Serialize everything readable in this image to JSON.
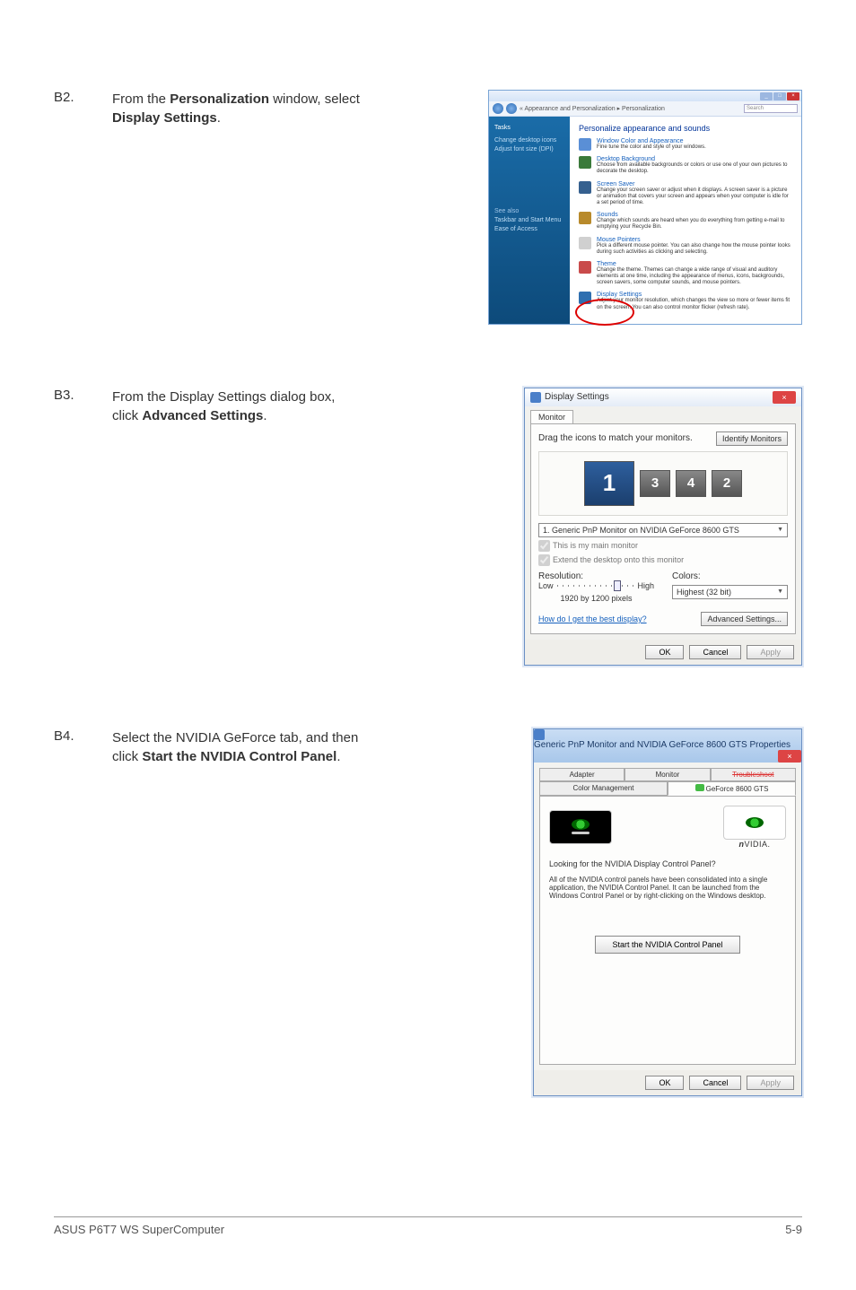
{
  "steps": {
    "b2": {
      "label": "B2.",
      "text_pre": "From the ",
      "bold1": "Personalization",
      "mid": " window, select ",
      "bold2": "Display Settings",
      "post": "."
    },
    "b3": {
      "label": "B3.",
      "text_pre": "From the Display Settings dialog box, click ",
      "bold1": "Advanced Settings",
      "post": "."
    },
    "b4": {
      "label": "B4.",
      "text_pre": "Select the NVIDIA GeForce tab, and then click ",
      "bold1": "Start the NVIDIA Control Panel",
      "post": "."
    }
  },
  "vista": {
    "breadcrumb": "« Appearance and Personalization ▸ Personalization",
    "search_ph": "Search",
    "tasks": "Tasks",
    "side1": "Change desktop icons",
    "side2": "Adjust font size (DPI)",
    "seealso": "See also",
    "side3": "Taskbar and Start Menu",
    "side4": "Ease of Access",
    "heading": "Personalize appearance and sounds",
    "items": [
      {
        "title": "Window Color and Appearance",
        "desc": "Fine tune the color and style of your windows.",
        "iconColor": "#5a8fd6"
      },
      {
        "title": "Desktop Background",
        "desc": "Choose from available backgrounds or colors or use one of your own pictures to decorate the desktop.",
        "iconColor": "#3a7a3a"
      },
      {
        "title": "Screen Saver",
        "desc": "Change your screen saver or adjust when it displays. A screen saver is a picture or animation that covers your screen and appears when your computer is idle for a set period of time.",
        "iconColor": "#35608f"
      },
      {
        "title": "Sounds",
        "desc": "Change which sounds are heard when you do everything from getting e-mail to emptying your Recycle Bin.",
        "iconColor": "#b88a2b"
      },
      {
        "title": "Mouse Pointers",
        "desc": "Pick a different mouse pointer. You can also change how the mouse pointer looks during such activities as clicking and selecting.",
        "iconColor": "#d0d0d0"
      },
      {
        "title": "Theme",
        "desc": "Change the theme. Themes can change a wide range of visual and auditory elements at one time, including the appearance of menus, icons, backgrounds, screen savers, some computer sounds, and mouse pointers.",
        "iconColor": "#c94b4b"
      },
      {
        "title": "Display Settings",
        "desc": "Adjust your monitor resolution, which changes the view so more or fewer items fit on the screen. You can also control monitor flicker (refresh rate).",
        "iconColor": "#2f6fb0"
      }
    ]
  },
  "display": {
    "title": "Display Settings",
    "tab": "Monitor",
    "drag": "Drag the icons to match your monitors.",
    "identify": "Identify Monitors",
    "monitor_combo": "1. Generic PnP Monitor on NVIDIA GeForce 8600 GTS",
    "chk_main": "This is my main monitor",
    "chk_extend": "Extend the desktop onto this monitor",
    "res_label": "Resolution:",
    "low": "Low",
    "high": "High",
    "res_value": "1920 by 1200 pixels",
    "colors_label": "Colors:",
    "colors_value": "Highest (32 bit)",
    "help": "How do I get the best display?",
    "adv": "Advanced Settings...",
    "ok": "OK",
    "cancel": "Cancel",
    "apply": "Apply"
  },
  "props": {
    "title": "Generic PnP Monitor and NVIDIA GeForce 8600 GTS Properties",
    "tabs_row1": [
      "Adapter",
      "Monitor",
      "Troubleshoot"
    ],
    "tabs_row2": [
      "Color Management",
      "GeForce 8600 GTS"
    ],
    "nvidia": "VIDIA.",
    "nvidia_prefix": "n",
    "q": "Looking for the NVIDIA Display Control Panel?",
    "desc": "All of the NVIDIA control panels have been consolidated into a single application, the NVIDIA Control Panel. It can be launched from the Windows Control Panel or by right-clicking on the Windows desktop.",
    "start": "Start the NVIDIA Control Panel",
    "ok": "OK",
    "cancel": "Cancel",
    "apply": "Apply"
  },
  "footer": {
    "left": "ASUS P6T7 WS SuperComputer",
    "right": "5-9"
  }
}
